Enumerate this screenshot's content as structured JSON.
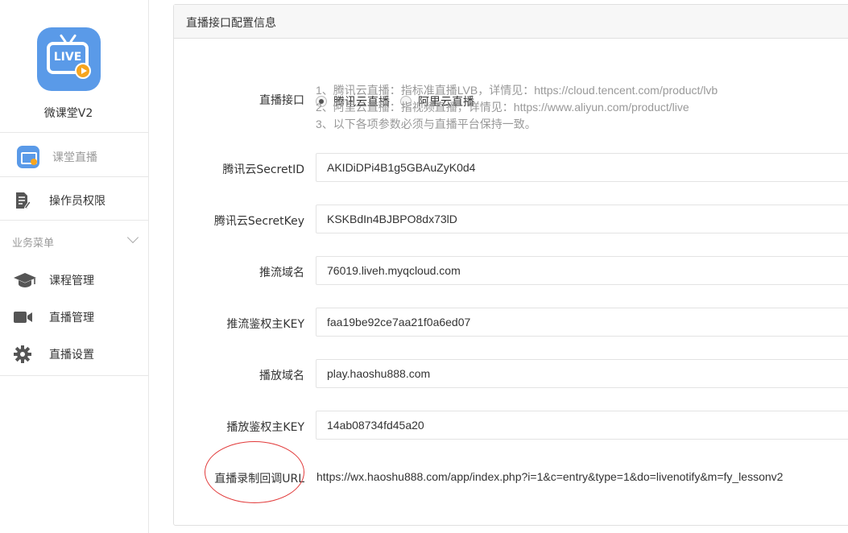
{
  "sidebar": {
    "brand_name": "微课堂V2",
    "logo_text": "LIVE",
    "items": [
      {
        "label": "课堂直播",
        "icon": "live-tv-icon"
      },
      {
        "label": "操作员权限",
        "icon": "document-edit-icon"
      }
    ],
    "section_label": "业务菜单",
    "menu": [
      {
        "label": "课程管理",
        "icon": "graduation-cap-icon"
      },
      {
        "label": "直播管理",
        "icon": "video-camera-icon"
      },
      {
        "label": "直播设置",
        "icon": "gear-icon"
      }
    ]
  },
  "panel": {
    "title": "直播接口配置信息",
    "interface": {
      "label": "直播接口",
      "options": [
        "腾讯云直播",
        "阿里云直播"
      ],
      "selected": "腾讯云直播",
      "help": [
        "1、腾讯云直播：指标准直播LVB，详情见：https://cloud.tencent.com/product/lvb",
        "2、阿里云直播：指视频直播，详情见：https://www.aliyun.com/product/live",
        "3、以下各项参数必须与直播平台保持一致。"
      ]
    },
    "fields": [
      {
        "label": "腾讯云SecretID",
        "value": "AKIDiDPi4B1g5GBAuZyK0d4"
      },
      {
        "label": "腾讯云SecretKey",
        "value": "KSKBdIn4BJBPO8dx73lD"
      },
      {
        "label": "推流域名",
        "value": "76019.liveh.myqcloud.com"
      },
      {
        "label": "推流鉴权主KEY",
        "value": "faa19be92ce7aa21f0a6ed07"
      },
      {
        "label": "播放域名",
        "value": "play.haoshu888.com"
      },
      {
        "label": "播放鉴权主KEY",
        "value": "14ab08734fd45a20"
      }
    ],
    "callback": {
      "label": "直播录制回调URL",
      "value": "https://wx.haoshu888.com/app/index.php?i=1&c=entry&type=1&do=livenotify&m=fy_lessonv2"
    }
  },
  "colors": {
    "accent": "#5a9ae8",
    "play": "#f7a51e",
    "annotation": "#e23a3a"
  }
}
